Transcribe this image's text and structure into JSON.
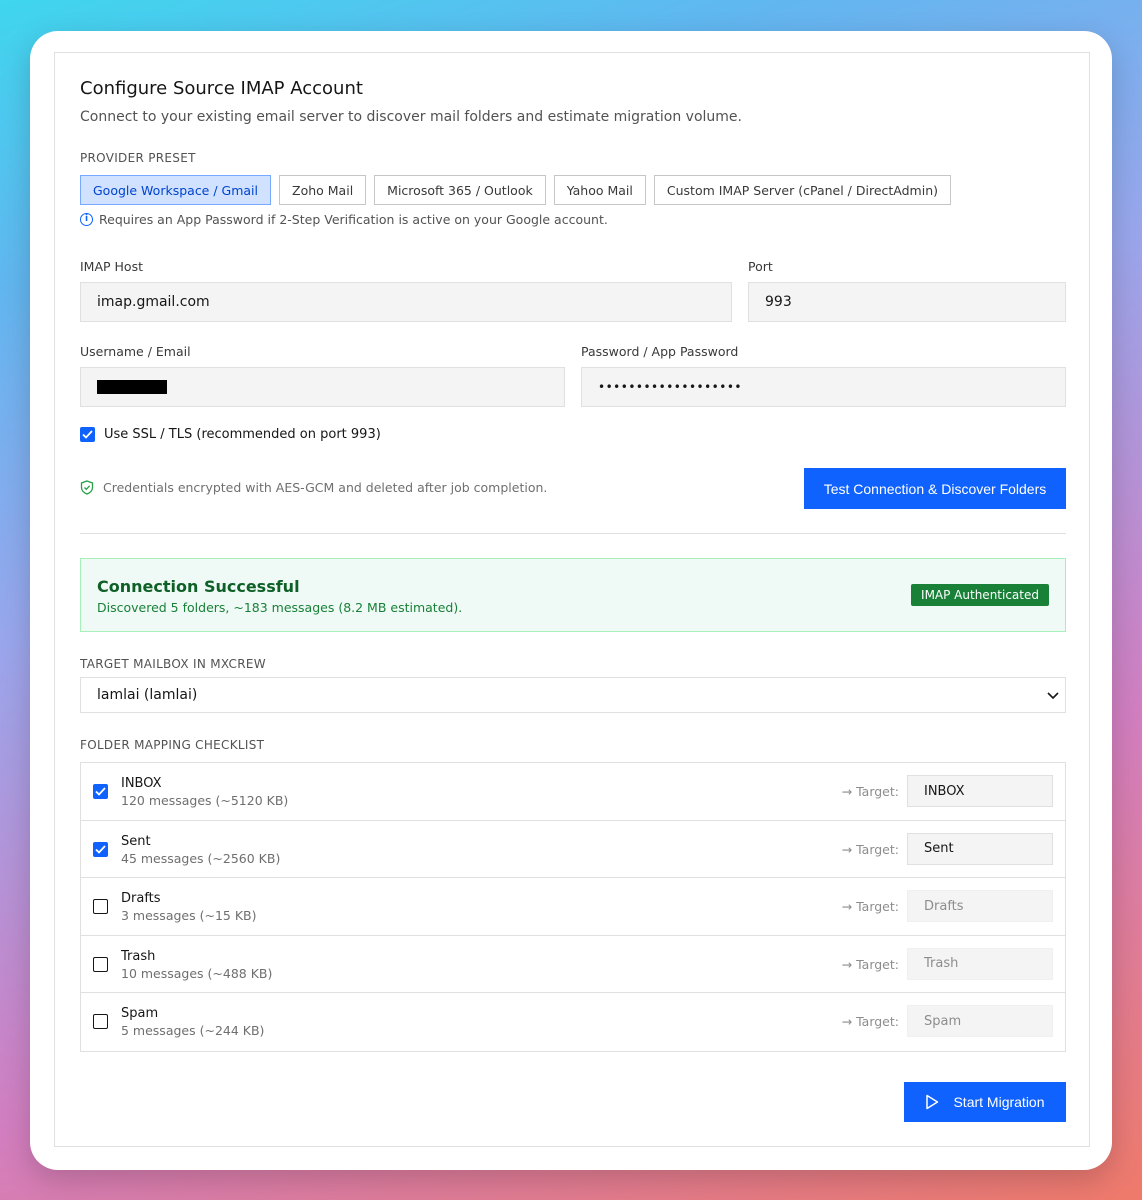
{
  "header": {
    "title": "Configure Source IMAP Account",
    "subtitle": "Connect to your existing email server to discover mail folders and estimate migration volume."
  },
  "provider": {
    "label": "PROVIDER PRESET",
    "presets": [
      {
        "label": "Google Workspace / Gmail",
        "active": true
      },
      {
        "label": "Zoho Mail",
        "active": false
      },
      {
        "label": "Microsoft 365 / Outlook",
        "active": false
      },
      {
        "label": "Yahoo Mail",
        "active": false
      },
      {
        "label": "Custom IMAP Server (cPanel / DirectAdmin)",
        "active": false
      }
    ],
    "hint": "Requires an App Password if 2-Step Verification is active on your Google account."
  },
  "form": {
    "host_label": "IMAP Host",
    "host_value": "imap.gmail.com",
    "port_label": "Port",
    "port_value": "993",
    "username_label": "Username / Email",
    "password_label": "Password / App Password",
    "password_value": "•••••••••••••••••••",
    "ssl_label": "Use SSL / TLS (recommended on port 993)",
    "ssl_checked": true,
    "secure_note": "Credentials encrypted with AES-GCM and deleted after job completion.",
    "test_button": "Test Connection & Discover Folders"
  },
  "status": {
    "title": "Connection Successful",
    "details": "Discovered 5 folders, ~183 messages (8.2 MB estimated).",
    "badge": "IMAP Authenticated"
  },
  "target_mailbox": {
    "label": "TARGET MAILBOX IN MXCREW",
    "selected": "lamlai (lamlai)"
  },
  "folders": {
    "label": "FOLDER MAPPING CHECKLIST",
    "target_label": "→ Target:",
    "items": [
      {
        "name": "INBOX",
        "count": "120 messages (~5120 KB)",
        "target": "INBOX",
        "checked": true
      },
      {
        "name": "Sent",
        "count": "45 messages (~2560 KB)",
        "target": "Sent",
        "checked": true
      },
      {
        "name": "Drafts",
        "count": "3 messages (~15 KB)",
        "target": "Drafts",
        "checked": false
      },
      {
        "name": "Trash",
        "count": "10 messages (~488 KB)",
        "target": "Trash",
        "checked": false
      },
      {
        "name": "Spam",
        "count": "5 messages (~244 KB)",
        "target": "Spam",
        "checked": false
      }
    ]
  },
  "actions": {
    "start_button": "Start Migration"
  },
  "colors": {
    "primary": "#0f62fe",
    "success": "#198038",
    "success_bg": "#effaf6"
  }
}
